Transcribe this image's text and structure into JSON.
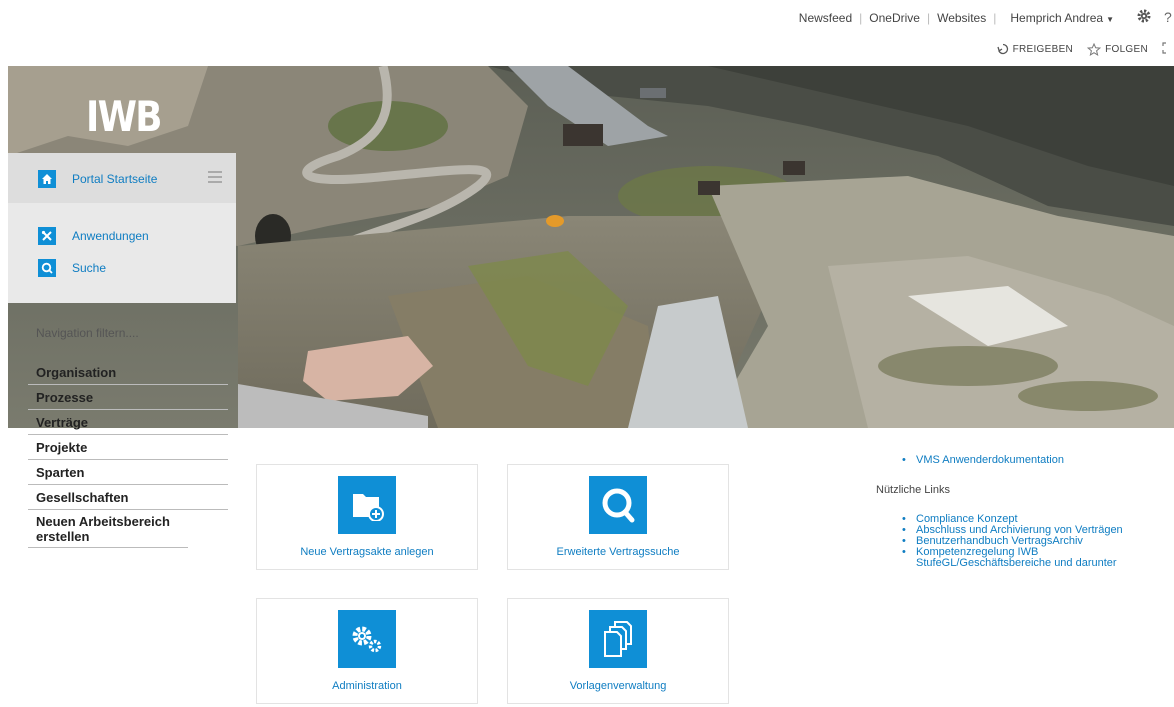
{
  "suite_bar": {
    "links": [
      "Newsfeed",
      "OneDrive",
      "Websites"
    ],
    "user": "Hemprich Andrea",
    "help_glyph": "?"
  },
  "action_bar": {
    "share": "FREIGEBEN",
    "follow": "FOLGEN"
  },
  "logo": {
    "text": "IWB"
  },
  "nav_panel": {
    "home": "Portal Startseite",
    "apps": "Anwendungen",
    "search": "Suche"
  },
  "nav_filter": "Navigation filtern....",
  "nav_items": [
    "Organisation",
    "Prozesse",
    "Verträge",
    "Projekte",
    "Sparten",
    "Gesellschaften",
    "Neuen Arbeitsbereich erstellen"
  ],
  "tiles": [
    {
      "label": "Neue Vertragsakte anlegen",
      "icon": "folder-plus-icon"
    },
    {
      "label": "Erweiterte Vertragssuche",
      "icon": "search-icon"
    },
    {
      "label": "Administration",
      "icon": "gears-icon"
    },
    {
      "label": "Vorlagenverwaltung",
      "icon": "documents-icon"
    }
  ],
  "right_links": {
    "top_link": "VMS Anwenderdokumentation",
    "heading": "Nützliche Links",
    "links": [
      "Compliance Konzept",
      "Abschluss und Archivierung von Verträgen",
      "Benutzerhandbuch VertragsArchiv",
      "Kompetenzregelung IWB StufeGL/Geschäftsbereiche und darunter"
    ]
  },
  "colors": {
    "accent": "#0f8fd6",
    "link": "#0f7dc2",
    "nav_bg": "#e9e9e9"
  }
}
